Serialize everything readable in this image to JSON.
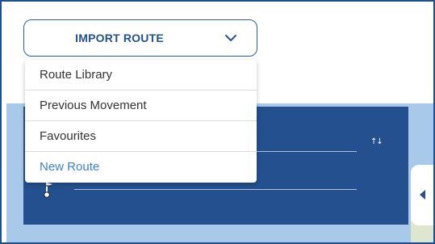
{
  "import_button": {
    "label": "IMPORT ROUTE",
    "icon": "chevron-down-icon"
  },
  "dropdown": {
    "items": [
      {
        "label": "Route Library"
      },
      {
        "label": "Previous Movement"
      },
      {
        "label": "Favourites"
      },
      {
        "label": "New Route"
      }
    ],
    "highlighted_item": "New Route"
  },
  "route_panel": {
    "sort_icon": "sort-icon",
    "pin_icon": "map-pin-icon"
  },
  "side_tab": {
    "icon": "chevron-left-icon"
  },
  "colors": {
    "primary": "#24508f",
    "accent_link": "#3c7fd4",
    "map_water": "#a9c9ea",
    "text": "#333333"
  }
}
